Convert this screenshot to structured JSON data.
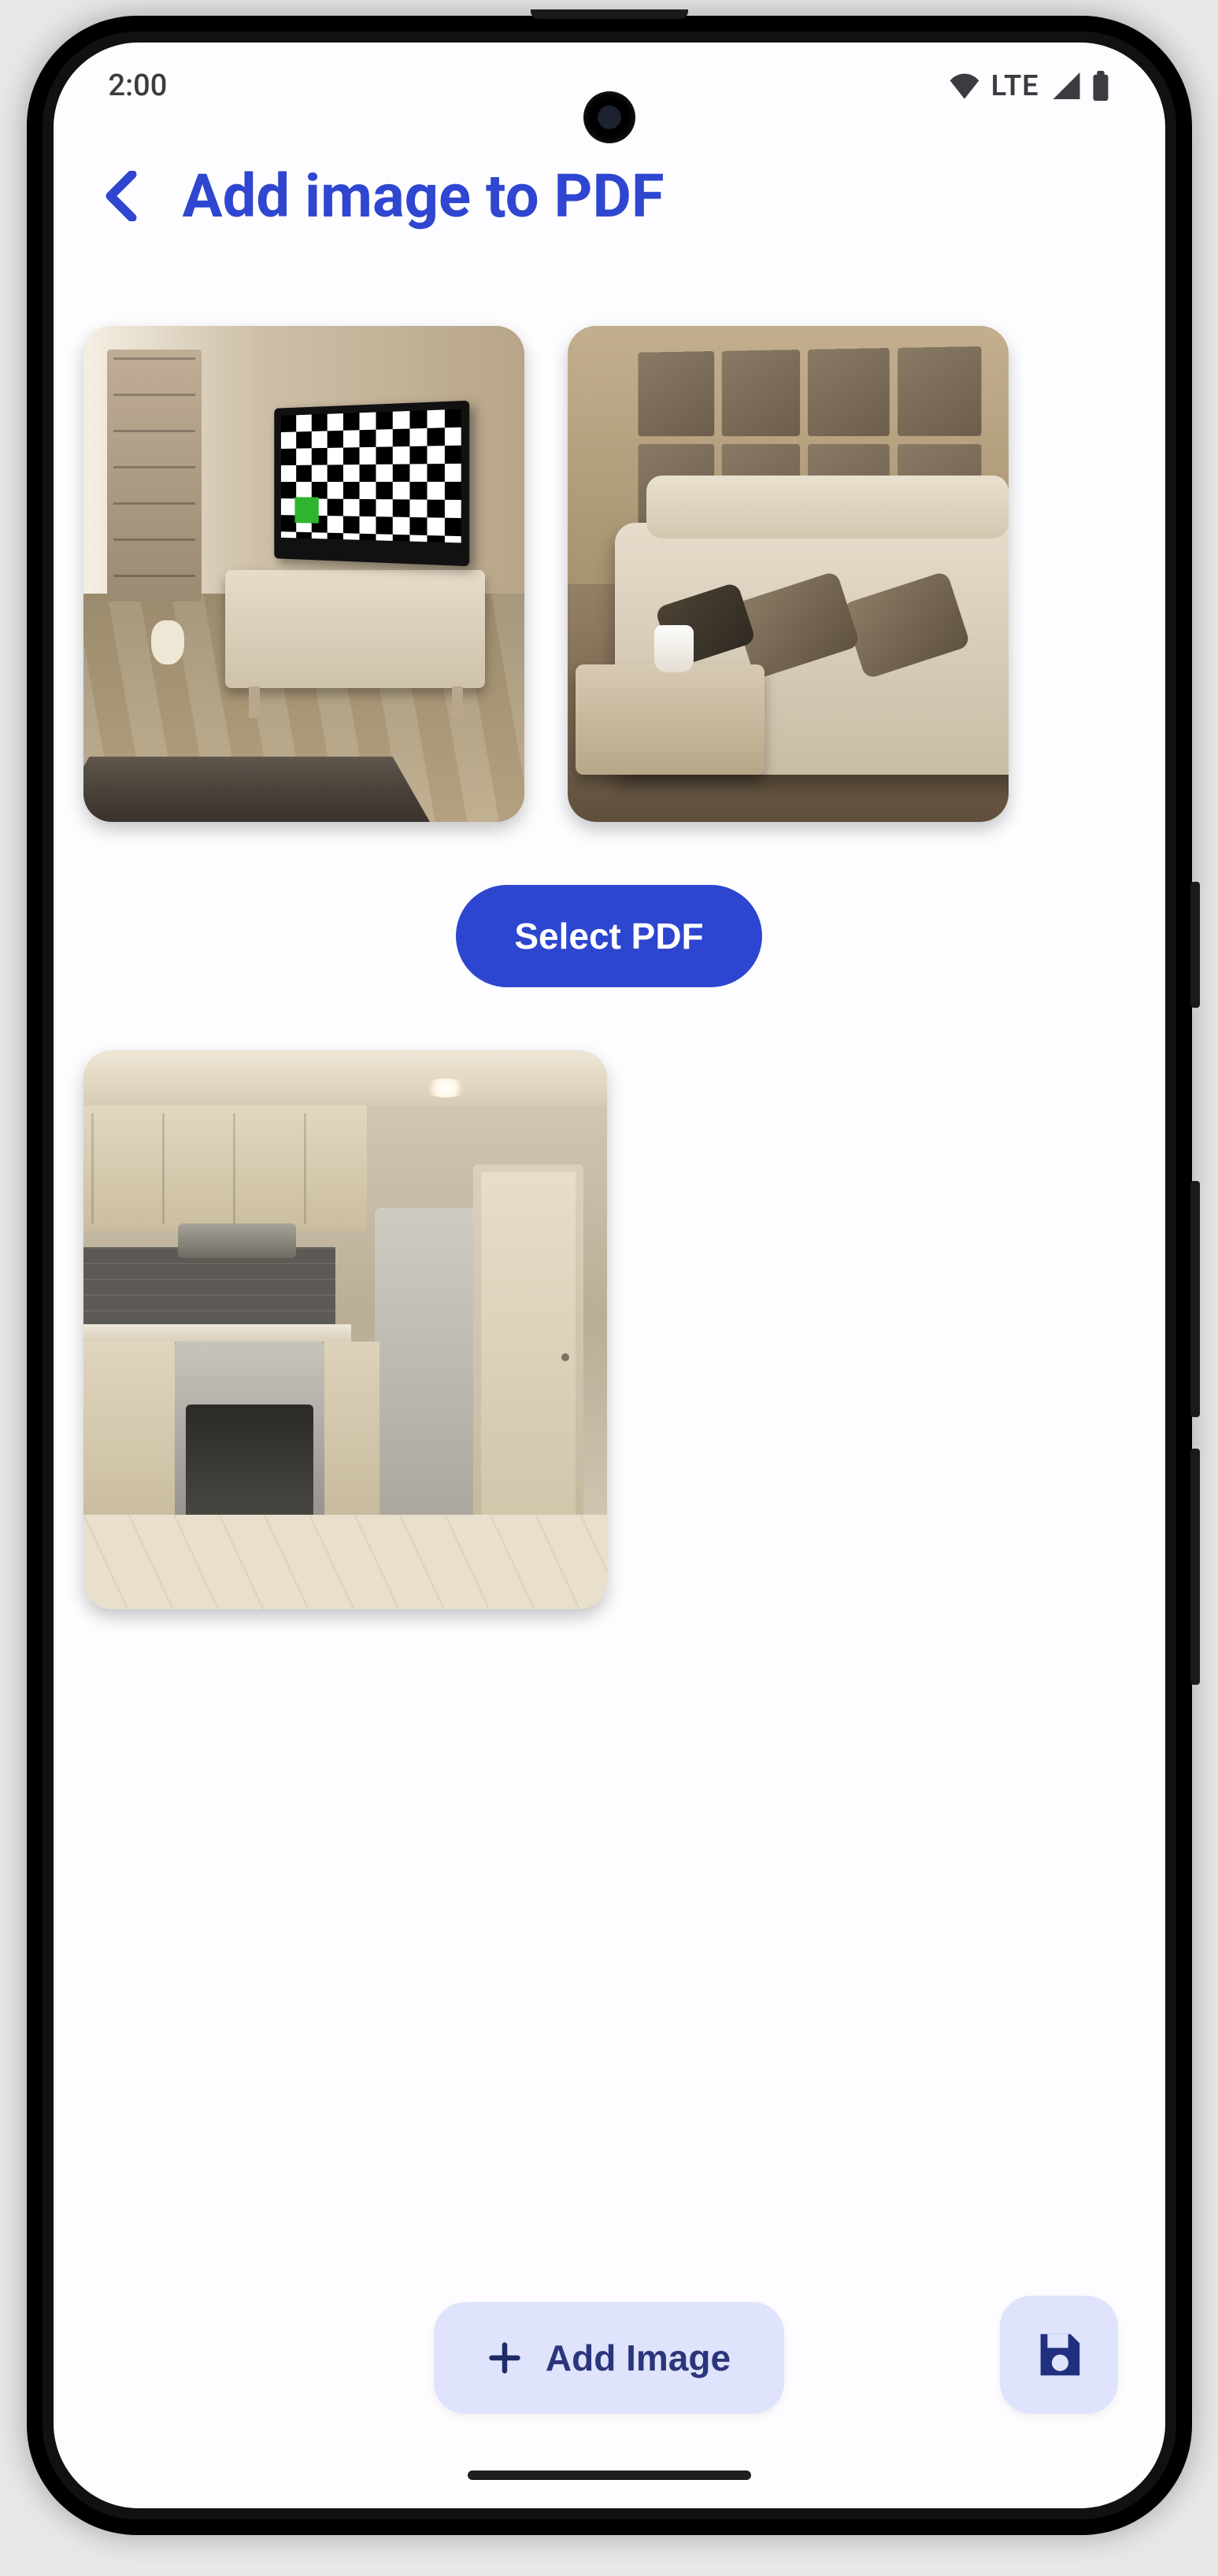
{
  "status": {
    "time": "2:00",
    "network_label": "LTE"
  },
  "colors": {
    "accent": "#2d46cf",
    "fab_bg": "#dfe3fb",
    "fab_icon": "#21307e"
  },
  "header": {
    "title": "Add image to PDF",
    "back_icon": "chevron-left-icon"
  },
  "images": [
    {
      "name": "living-room-tv"
    },
    {
      "name": "living-room-sofa"
    },
    {
      "name": "kitchen"
    }
  ],
  "buttons": {
    "select_pdf_label": "Select PDF",
    "add_image_label": "Add Image",
    "add_image_icon": "plus-icon",
    "save_icon": "save-icon"
  }
}
